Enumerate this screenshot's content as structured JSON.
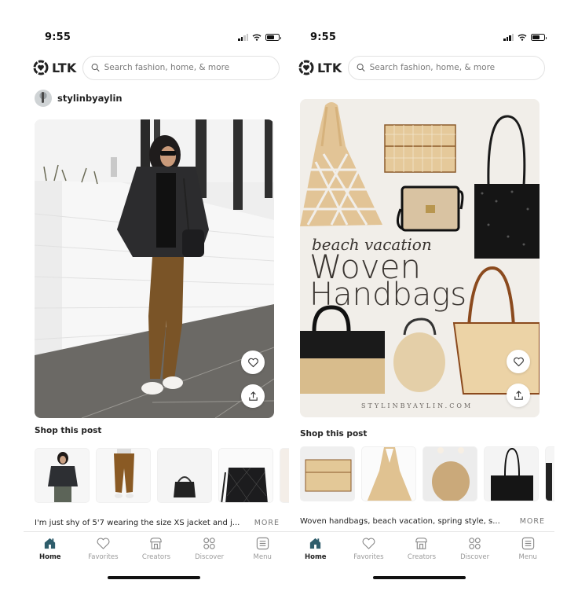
{
  "colors": {
    "accent": "#2e5d6b",
    "text": "#222222",
    "muted": "#9a9a9a",
    "border": "#e2e2e2"
  },
  "screens": [
    {
      "status": {
        "time": "9:55"
      },
      "header": {
        "logo_text": "LTK",
        "search_placeholder": "Search fashion, home, & more"
      },
      "creator": {
        "name": "stylinbyaylin"
      },
      "post": {
        "image_alt": "Woman in black sherpa jacket, brown joggers and white sneakers walking past white brick wall",
        "like_icon": "heart-icon",
        "share_icon": "share-icon"
      },
      "shop": {
        "title": "Shop this post",
        "products": [
          {
            "name": "Black sherpa jacket"
          },
          {
            "name": "Brown joggers"
          },
          {
            "name": "Black quilted bucket bag"
          },
          {
            "name": "Black quilted bucket bag (close-up)"
          },
          {
            "name": "Partial product"
          }
        ]
      },
      "caption": {
        "text": "I'm just shy of 5'7 wearing the size XS jacket and j...",
        "more_label": "MORE"
      }
    },
    {
      "status": {
        "time": "9:55"
      },
      "header": {
        "logo_text": "LTK",
        "search_placeholder": "Search fashion, home, & more"
      },
      "post": {
        "image_alt": "Collage of woven handbags",
        "overlay_script": "beach vacation",
        "overlay_line1": "Woven",
        "overlay_line2": "Handbags",
        "watermark": "STYLINBYAYLIN.COM",
        "like_icon": "heart-icon",
        "share_icon": "share-icon"
      },
      "shop": {
        "title": "Shop this post",
        "products": [
          {
            "name": "Rattan clutch"
          },
          {
            "name": "Macrame net tote"
          },
          {
            "name": "Woven basket bag with pearl handle"
          },
          {
            "name": "Black woven tote"
          },
          {
            "name": "Partial product"
          }
        ]
      },
      "caption": {
        "text": "Woven handbags, beach vacation, spring style, s...",
        "more_label": "MORE"
      }
    }
  ],
  "tabbar": {
    "items": [
      {
        "label": "Home",
        "icon": "home-icon",
        "active": true
      },
      {
        "label": "Favorites",
        "icon": "heart-icon",
        "active": false
      },
      {
        "label": "Creators",
        "icon": "storefront-icon",
        "active": false
      },
      {
        "label": "Discover",
        "icon": "grid-icon",
        "active": false
      },
      {
        "label": "Menu",
        "icon": "menu-icon",
        "active": false
      }
    ]
  }
}
